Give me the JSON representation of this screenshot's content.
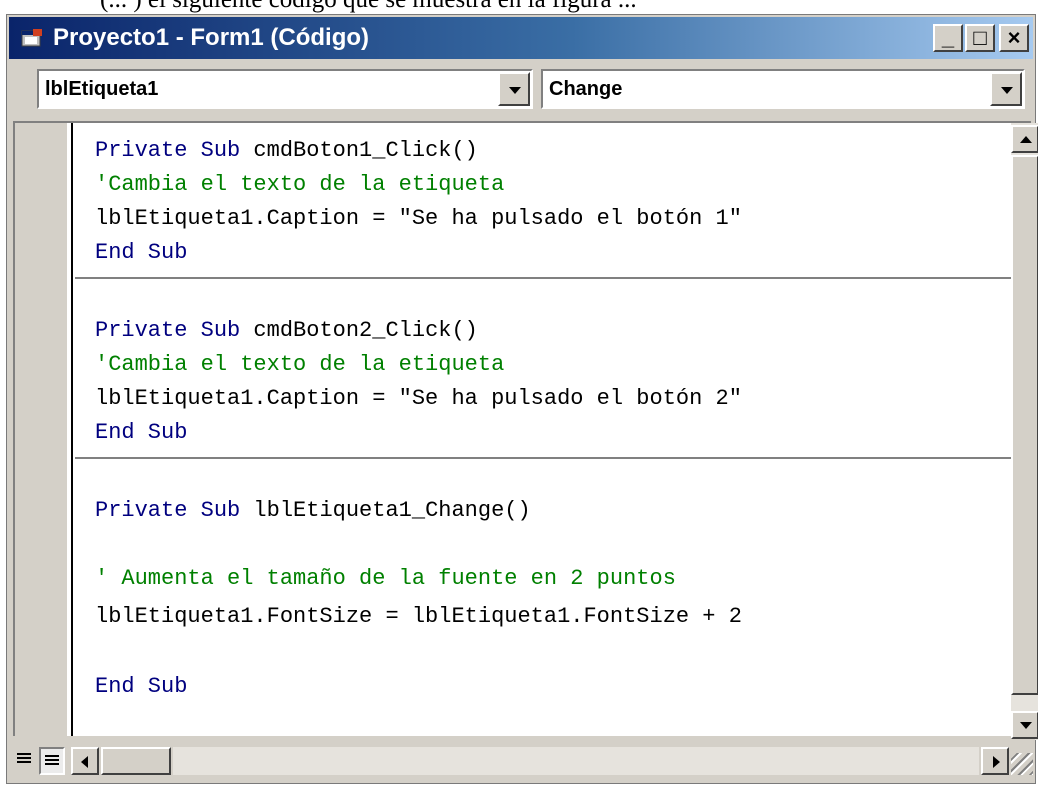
{
  "page_text": {
    "top_partial": "(... ) el siguiente código que se muestra en la figura ..."
  },
  "window": {
    "title": "Proyecto1 - Form1 (Código)",
    "controls": {
      "minimize": "_",
      "maximize": "□",
      "close": "×"
    }
  },
  "toolbar": {
    "object_combo_value": "lblEtiqueta1",
    "procedure_combo_value": "Change"
  },
  "code": {
    "blocks": [
      {
        "lines": [
          {
            "kw1": "Private Sub",
            "rest": " cmdBoton1_Click()"
          },
          {
            "comment": "'Cambia el texto de la etiqueta"
          },
          {
            "text": "lblEtiqueta1.Caption = \"Se ha pulsado el botón 1\""
          },
          {
            "kw1": "End Sub",
            "rest": ""
          }
        ]
      },
      {
        "lines": [
          {
            "kw1": "Private Sub",
            "rest": " cmdBoton2_Click()"
          },
          {
            "comment": "'Cambia el texto de la etiqueta"
          },
          {
            "text": "lblEtiqueta1.Caption = \"Se ha pulsado el botón 2\""
          },
          {
            "kw1": "End Sub",
            "rest": ""
          }
        ]
      },
      {
        "lines": [
          {
            "kw1": "Private Sub",
            "rest": " lblEtiqueta1_Change()"
          },
          {
            "comment": "' Aumenta el tamaño de la fuente en 2 puntos"
          },
          {
            "text": "lblEtiqueta1.FontSize = lblEtiqueta1.FontSize + 2"
          },
          {
            "kw1": "End Sub",
            "rest": ""
          }
        ]
      }
    ]
  },
  "colors": {
    "keyword": "#00007f",
    "comment": "#008000",
    "text": "#000000",
    "title_bar_start": "#0a246a",
    "title_bar_end": "#a6caf0"
  }
}
